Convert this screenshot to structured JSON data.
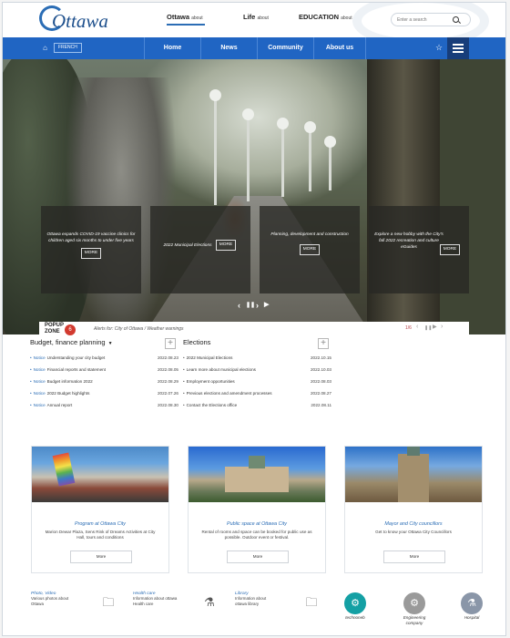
{
  "site": {
    "logo_text": "Ottawa"
  },
  "topnav": [
    {
      "label": "Ottawa",
      "sub": "about"
    },
    {
      "label": "Life",
      "sub": "about"
    },
    {
      "label": "EDUCATION",
      "sub": "about"
    }
  ],
  "search": {
    "placeholder": "Enter a search"
  },
  "navbar": {
    "language": "FRENCH",
    "items": [
      "Home",
      "News",
      "Community",
      "About us"
    ]
  },
  "hero": {
    "cards": [
      {
        "text": "Ottawa expands COVID-19 vaccine clinics for children aged six months to under five years",
        "more": "MORE"
      },
      {
        "text": "2022 Municipal Elections",
        "more": "MORE"
      },
      {
        "text": "Planning, development and construction",
        "more": "MORE"
      },
      {
        "text": "Explore a new hobby with the City's fall 2022 recreation and culture eGuides",
        "more": "MORE"
      }
    ]
  },
  "popup": {
    "label_line1": "POPUP",
    "label_line2": "ZONE",
    "count": "6",
    "news": "Alerts for: City of Ottawa / Weather warnings",
    "page": "1/6"
  },
  "boards": [
    {
      "title": "Budget, finance planning",
      "rows": [
        {
          "tag": "Notice",
          "text": "Understanding your city budget",
          "date": "2022.08.23"
        },
        {
          "tag": "Notice",
          "text": "Financial reports and statement",
          "date": "2022.08.05"
        },
        {
          "tag": "Notice",
          "text": "Budget information 2022",
          "date": "2022.08.29"
        },
        {
          "tag": "Notice",
          "text": "2022 Budget highlights",
          "date": "2022.07.26"
        },
        {
          "tag": "Notice",
          "text": "Annual report",
          "date": "2022.08.30"
        }
      ]
    },
    {
      "title": "Elections",
      "rows": [
        {
          "tag": "",
          "text": "2022  Municipal Elections",
          "date": "2022.10.15"
        },
        {
          "tag": "",
          "text": "Learn more about municipal elections",
          "date": "2022.10.03"
        },
        {
          "tag": "",
          "text": "Employment opportunities",
          "date": "2022.08.03"
        },
        {
          "tag": "",
          "text": "Previous elections and amendment processes",
          "date": "2022.08.27"
        },
        {
          "tag": "",
          "text": "Contact the Elections office",
          "date": "2022.08.11"
        }
      ]
    }
  ],
  "features": [
    {
      "title": "Program at Ottawa City",
      "desc": "Marion Dewar Plaza, Sens Rink of Dreams Activities at City Hall, tours and conditions",
      "more": "More"
    },
    {
      "title": "Public space at Ottawa City",
      "desc": "Rental of rooms and space can be booked for public use as possible. Outdoor event or festival.",
      "more": "More"
    },
    {
      "title": "Mayor and City councillors",
      "desc": "Get to know your Ottawa City Councillors",
      "more": "More"
    }
  ],
  "quicklinks": [
    {
      "title": "Photo, Video",
      "desc": "Various photos about Ottawa"
    },
    {
      "title": "Health care",
      "desc": "Information about ottawa Health care"
    },
    {
      "title": "Library",
      "desc": "Information about ottawa library"
    }
  ],
  "circles": [
    "technoneb",
    "Engineering company",
    "Hospital"
  ]
}
